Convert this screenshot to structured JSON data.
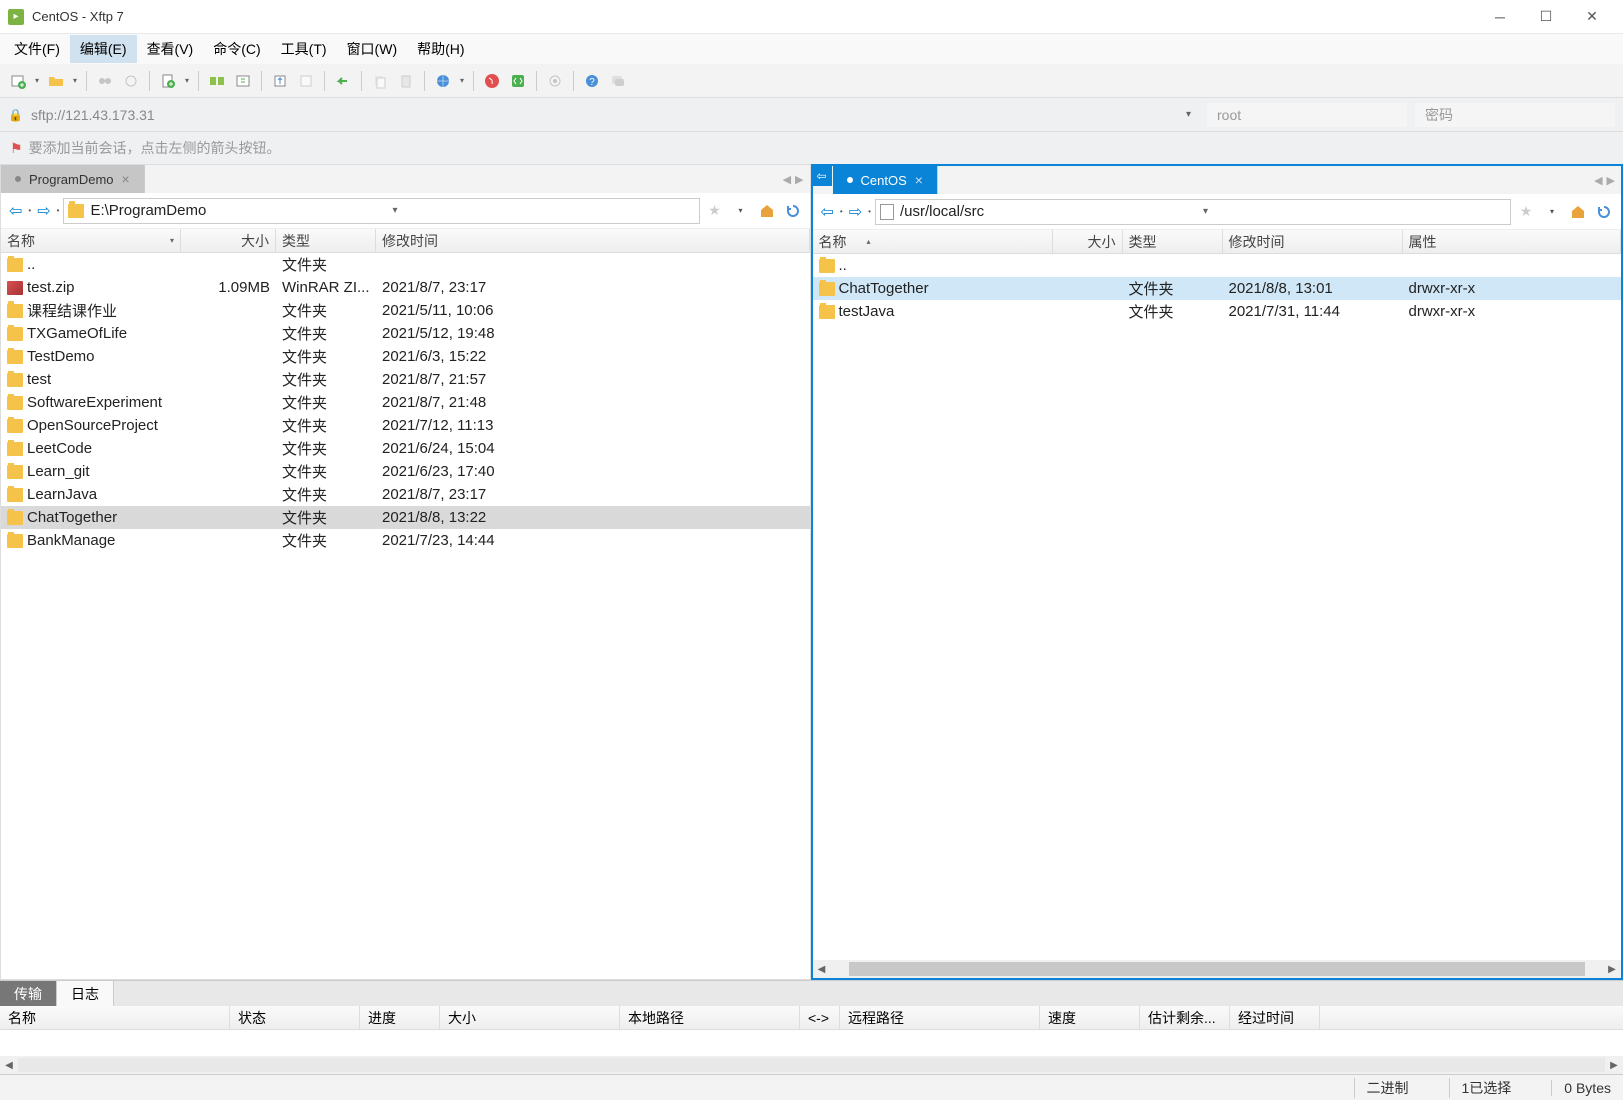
{
  "title": "CentOS - Xftp 7",
  "menu": [
    "文件(F)",
    "编辑(E)",
    "查看(V)",
    "命令(C)",
    "工具(T)",
    "窗口(W)",
    "帮助(H)"
  ],
  "menu_active_index": 1,
  "address": "sftp://121.43.173.31",
  "user_placeholder": "root",
  "pass_placeholder": "密码",
  "hint": "要添加当前会话，点击左侧的箭头按钮。",
  "left": {
    "tab": "ProgramDemo",
    "path": "E:\\ProgramDemo",
    "headers": {
      "name": "名称",
      "size": "大小",
      "type": "类型",
      "modified": "修改时间"
    },
    "rows": [
      {
        "icon": "folder",
        "name": "..",
        "size": "",
        "type": "文件夹",
        "modified": ""
      },
      {
        "icon": "zip",
        "name": "test.zip",
        "size": "1.09MB",
        "type": "WinRAR ZI...",
        "modified": "2021/8/7, 23:17"
      },
      {
        "icon": "folder",
        "name": "课程结课作业",
        "size": "",
        "type": "文件夹",
        "modified": "2021/5/11, 10:06"
      },
      {
        "icon": "folder",
        "name": "TXGameOfLife",
        "size": "",
        "type": "文件夹",
        "modified": "2021/5/12, 19:48"
      },
      {
        "icon": "folder",
        "name": "TestDemo",
        "size": "",
        "type": "文件夹",
        "modified": "2021/6/3, 15:22"
      },
      {
        "icon": "folder",
        "name": "test",
        "size": "",
        "type": "文件夹",
        "modified": "2021/8/7, 21:57"
      },
      {
        "icon": "folder",
        "name": "SoftwareExperiment",
        "size": "",
        "type": "文件夹",
        "modified": "2021/8/7, 21:48"
      },
      {
        "icon": "folder",
        "name": "OpenSourceProject",
        "size": "",
        "type": "文件夹",
        "modified": "2021/7/12, 11:13"
      },
      {
        "icon": "folder",
        "name": "LeetCode",
        "size": "",
        "type": "文件夹",
        "modified": "2021/6/24, 15:04"
      },
      {
        "icon": "folder",
        "name": "Learn_git",
        "size": "",
        "type": "文件夹",
        "modified": "2021/6/23, 17:40"
      },
      {
        "icon": "folder",
        "name": "LearnJava",
        "size": "",
        "type": "文件夹",
        "modified": "2021/8/7, 23:17"
      },
      {
        "icon": "folder",
        "name": "ChatTogether",
        "size": "",
        "type": "文件夹",
        "modified": "2021/8/8, 13:22",
        "selected": "gray"
      },
      {
        "icon": "folder",
        "name": "BankManage",
        "size": "",
        "type": "文件夹",
        "modified": "2021/7/23, 14:44"
      }
    ]
  },
  "right": {
    "tab": "CentOS",
    "path": "/usr/local/src",
    "headers": {
      "name": "名称",
      "size": "大小",
      "type": "类型",
      "modified": "修改时间",
      "attrs": "属性"
    },
    "rows": [
      {
        "icon": "folder",
        "name": "..",
        "size": "",
        "type": "",
        "modified": "",
        "attrs": ""
      },
      {
        "icon": "folder",
        "name": "ChatTogether",
        "size": "",
        "type": "文件夹",
        "modified": "2021/8/8, 13:01",
        "attrs": "drwxr-xr-x",
        "selected": "blue"
      },
      {
        "icon": "folder",
        "name": "testJava",
        "size": "",
        "type": "文件夹",
        "modified": "2021/7/31, 11:44",
        "attrs": "drwxr-xr-x"
      }
    ]
  },
  "bottom_tabs": [
    "传输",
    "日志"
  ],
  "transfer_headers": [
    "名称",
    "状态",
    "进度",
    "大小",
    "本地路径",
    "<->",
    "远程路径",
    "速度",
    "估计剩余...",
    "经过时间"
  ],
  "status": {
    "mode": "二进制",
    "selected": "1已选择",
    "bytes": "0 Bytes"
  }
}
